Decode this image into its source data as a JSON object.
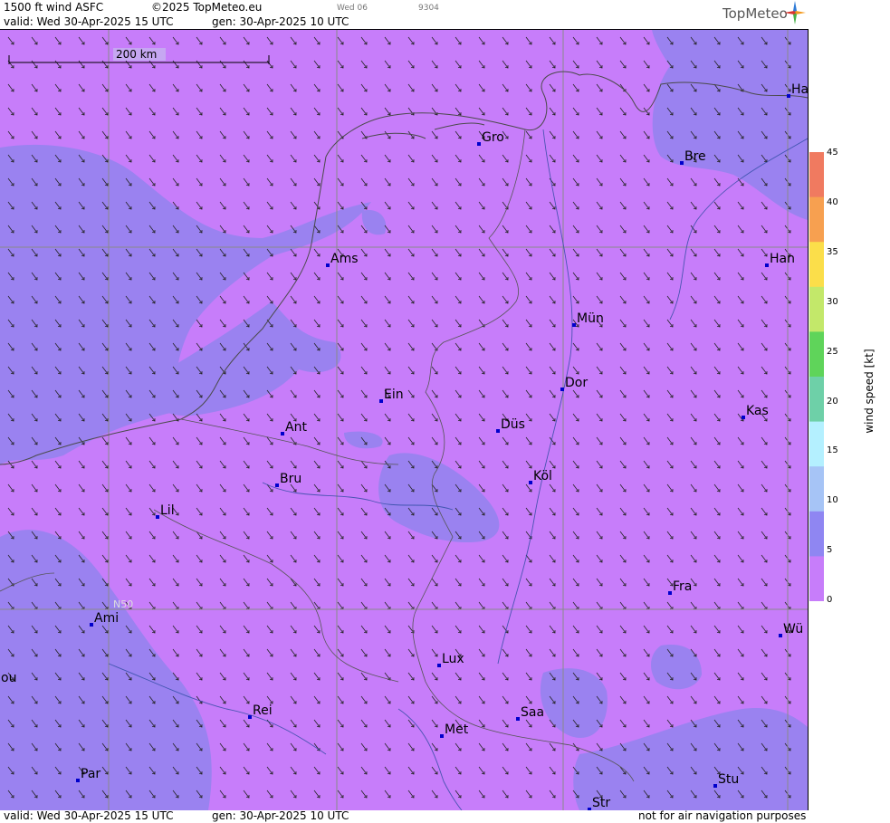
{
  "header": {
    "product": "1500 ft wind ASFC",
    "copyright": "©2025 TopMeteo.eu",
    "day_code": "Wed 06",
    "code": "9304",
    "valid": "valid:  Wed  30-Apr-2025  15 UTC",
    "generated": "gen: 30-Apr-2025 10 UTC",
    "brand": "TopMeteo"
  },
  "footer": {
    "valid": "valid:  Wed  30-Apr-2025  15 UTC",
    "generated": "gen: 30-Apr-2025 10 UTC",
    "disclaimer": "not for air navigation purposes"
  },
  "map": {
    "scale_label": "200 km",
    "latitude_label": "N50",
    "cities": [
      {
        "name": "Ha"
      },
      {
        "name": "Gro"
      },
      {
        "name": "Bre"
      },
      {
        "name": "Ams"
      },
      {
        "name": "Han"
      },
      {
        "name": "Mün"
      },
      {
        "name": "Ein"
      },
      {
        "name": "Dor"
      },
      {
        "name": "Kas"
      },
      {
        "name": "Ant"
      },
      {
        "name": "Düs"
      },
      {
        "name": "Bru"
      },
      {
        "name": "Köl"
      },
      {
        "name": "Lil"
      },
      {
        "name": "Fra"
      },
      {
        "name": "Ami"
      },
      {
        "name": "Wü"
      },
      {
        "name": "ou"
      },
      {
        "name": "Lux"
      },
      {
        "name": "Rei"
      },
      {
        "name": "Saa"
      },
      {
        "name": "Met"
      },
      {
        "name": "Par"
      },
      {
        "name": "Stu"
      },
      {
        "name": "Str"
      }
    ],
    "colors": {
      "calm": "#c77dfa",
      "light": "#9a82f0",
      "city_marker": "#0000cc"
    }
  },
  "legend": {
    "title": "wind  speed  [kt]",
    "ticks": [
      "45",
      "40",
      "35",
      "30",
      "25",
      "20",
      "15",
      "10",
      "5",
      "0"
    ],
    "colors": [
      "#f07a60",
      "#f7a050",
      "#fbde4a",
      "#c3e86a",
      "#5fd45a",
      "#6ed0a8",
      "#b4f0ff",
      "#a6c4f6",
      "#8f86f2",
      "#c77dfa"
    ]
  }
}
